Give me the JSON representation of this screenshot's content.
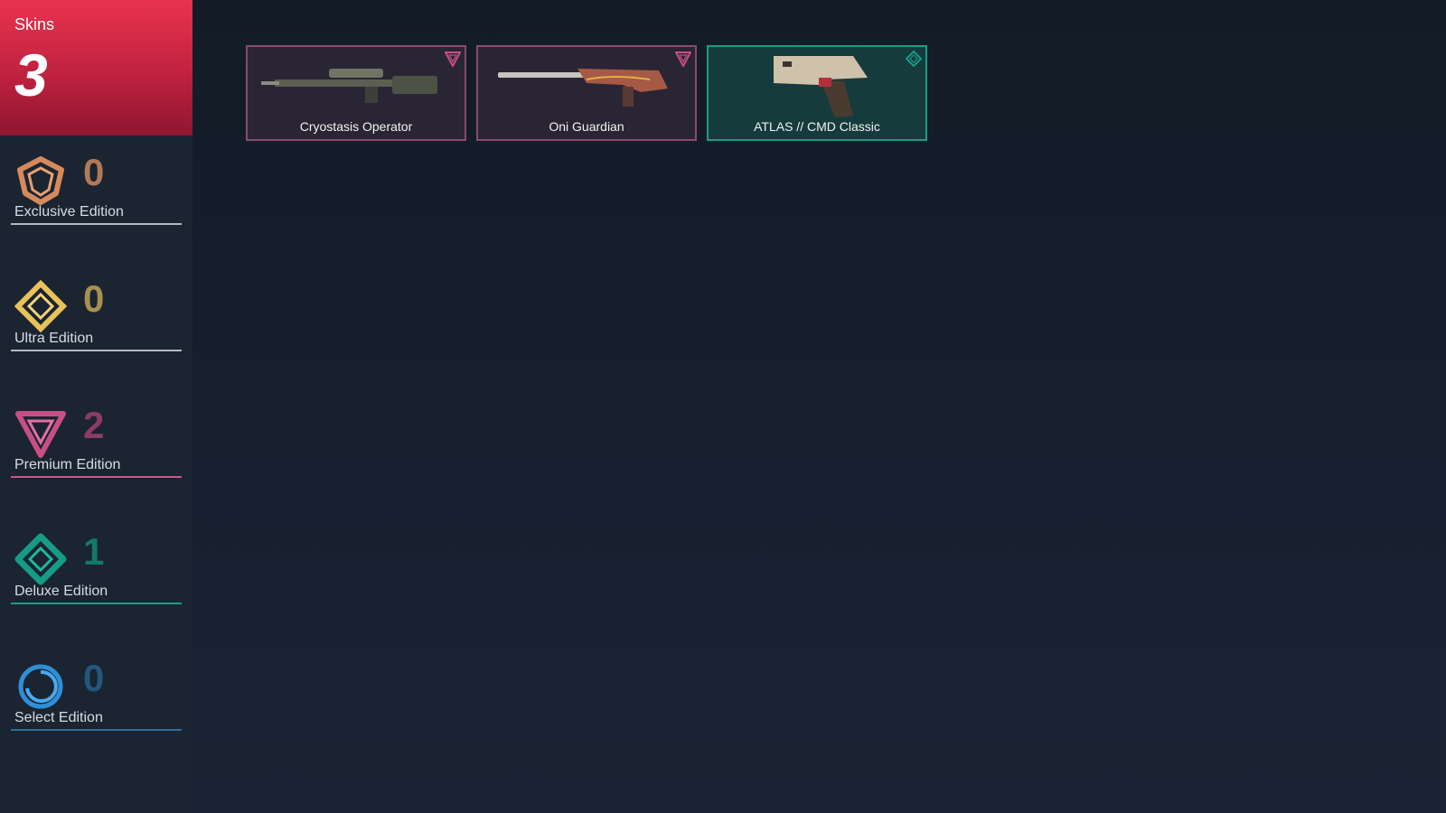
{
  "header": {
    "label": "Skins",
    "count": "3"
  },
  "tiers": [
    {
      "label": "Exclusive Edition",
      "count": "0",
      "color": "#d6895b",
      "icon": "exclusive-edition-icon"
    },
    {
      "label": "Ultra Edition",
      "count": "0",
      "color": "#e8c25a",
      "icon": "ultra-edition-icon"
    },
    {
      "label": "Premium Edition",
      "count": "2",
      "color": "#c84f86",
      "icon": "premium-edition-icon"
    },
    {
      "label": "Deluxe Edition",
      "count": "1",
      "color": "#169c86",
      "icon": "deluxe-edition-icon"
    },
    {
      "label": "Select Edition",
      "count": "0",
      "color": "#2f8ed6",
      "icon": "select-edition-icon"
    }
  ],
  "skins": [
    {
      "name": "Cryostasis Operator",
      "tier": "premium",
      "badge": "premium-edition-icon"
    },
    {
      "name": "Oni Guardian",
      "tier": "premium",
      "badge": "premium-edition-icon"
    },
    {
      "name": "ATLAS // CMD Classic",
      "tier": "deluxe",
      "badge": "deluxe-edition-icon"
    }
  ],
  "colors": {
    "header_red": "#e8334f",
    "premium_card_bg": "#2a2535",
    "premium_card_border": "#8a4a6c",
    "deluxe_card_bg": "#163b3d",
    "deluxe_card_border": "#1f9b86"
  }
}
